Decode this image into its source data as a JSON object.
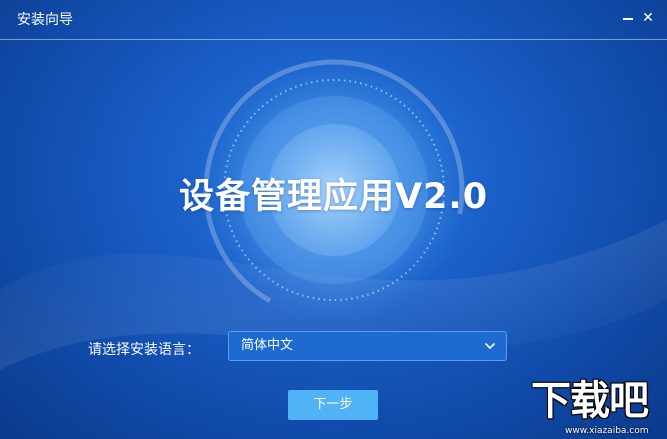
{
  "window": {
    "title": "安装向导",
    "minimize_glyph": "—",
    "close_glyph": "✕"
  },
  "hero": {
    "app_name": "设备管理应用V2.0"
  },
  "language": {
    "label": "请选择安装语言：",
    "selected": "简体中文"
  },
  "actions": {
    "next_label": "下一步"
  },
  "watermark": {
    "brand": "下载吧",
    "url": "www.xiazaiba.com"
  },
  "colors": {
    "background": "#1a5fc8",
    "button": "#4fb3f6",
    "select_bg": "#1d6bd0"
  },
  "icons": {
    "minimize": "minimize-icon",
    "close": "close-icon",
    "dropdown": "chevron-down-icon"
  }
}
